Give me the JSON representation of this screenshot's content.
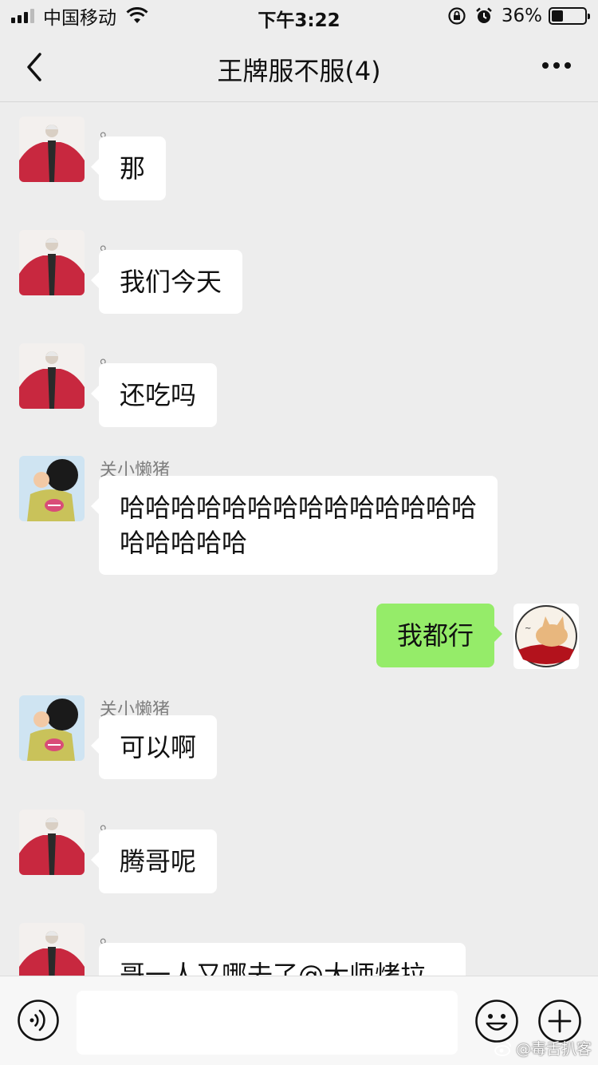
{
  "status_bar": {
    "carrier": "中国移动",
    "time": "下午3:22",
    "battery_percent": "36%",
    "battery_level": 0.36,
    "icons": [
      "signal-icon",
      "wifi-icon",
      "rotation-lock-icon",
      "alarm-icon",
      "battery-icon"
    ]
  },
  "nav": {
    "title": "王牌服不服(4)",
    "back_icon": "chevron-left-icon",
    "more_icon": "more-dots-icon"
  },
  "messages": [
    {
      "sender": "。",
      "text": "那",
      "side": "left",
      "avatar": "avatar-red-robe"
    },
    {
      "sender": "。",
      "text": "我们今天",
      "side": "left",
      "avatar": "avatar-red-robe"
    },
    {
      "sender": "。",
      "text": "还吃吗",
      "side": "left",
      "avatar": "avatar-red-robe"
    },
    {
      "sender": "关小懒猪",
      "text": "哈哈哈哈哈哈哈哈哈哈哈哈哈哈哈哈哈哈哈",
      "side": "left",
      "avatar": "avatar-cartoon-boy"
    },
    {
      "sender": "",
      "text": "我都行",
      "side": "right",
      "avatar": "avatar-cat"
    },
    {
      "sender": "关小懒猪",
      "text": "可以啊",
      "side": "left",
      "avatar": "avatar-cartoon-boy"
    },
    {
      "sender": "。",
      "text": "腾哥呢",
      "side": "left",
      "avatar": "avatar-red-robe"
    },
    {
      "sender": "。",
      "text": "哥一人又哪去了@大师烤拉",
      "side": "left",
      "avatar": "avatar-red-robe"
    }
  ],
  "input_bar": {
    "voice_icon": "voice-icon",
    "input_value": "",
    "emoji_icon": "emoji-icon",
    "plus_icon": "plus-icon"
  },
  "watermark": "@毒舌扒客",
  "colors": {
    "background": "#ededed",
    "bubble_in": "#ffffff",
    "bubble_out": "#95ec69",
    "sender_name": "#7f7f7f"
  }
}
